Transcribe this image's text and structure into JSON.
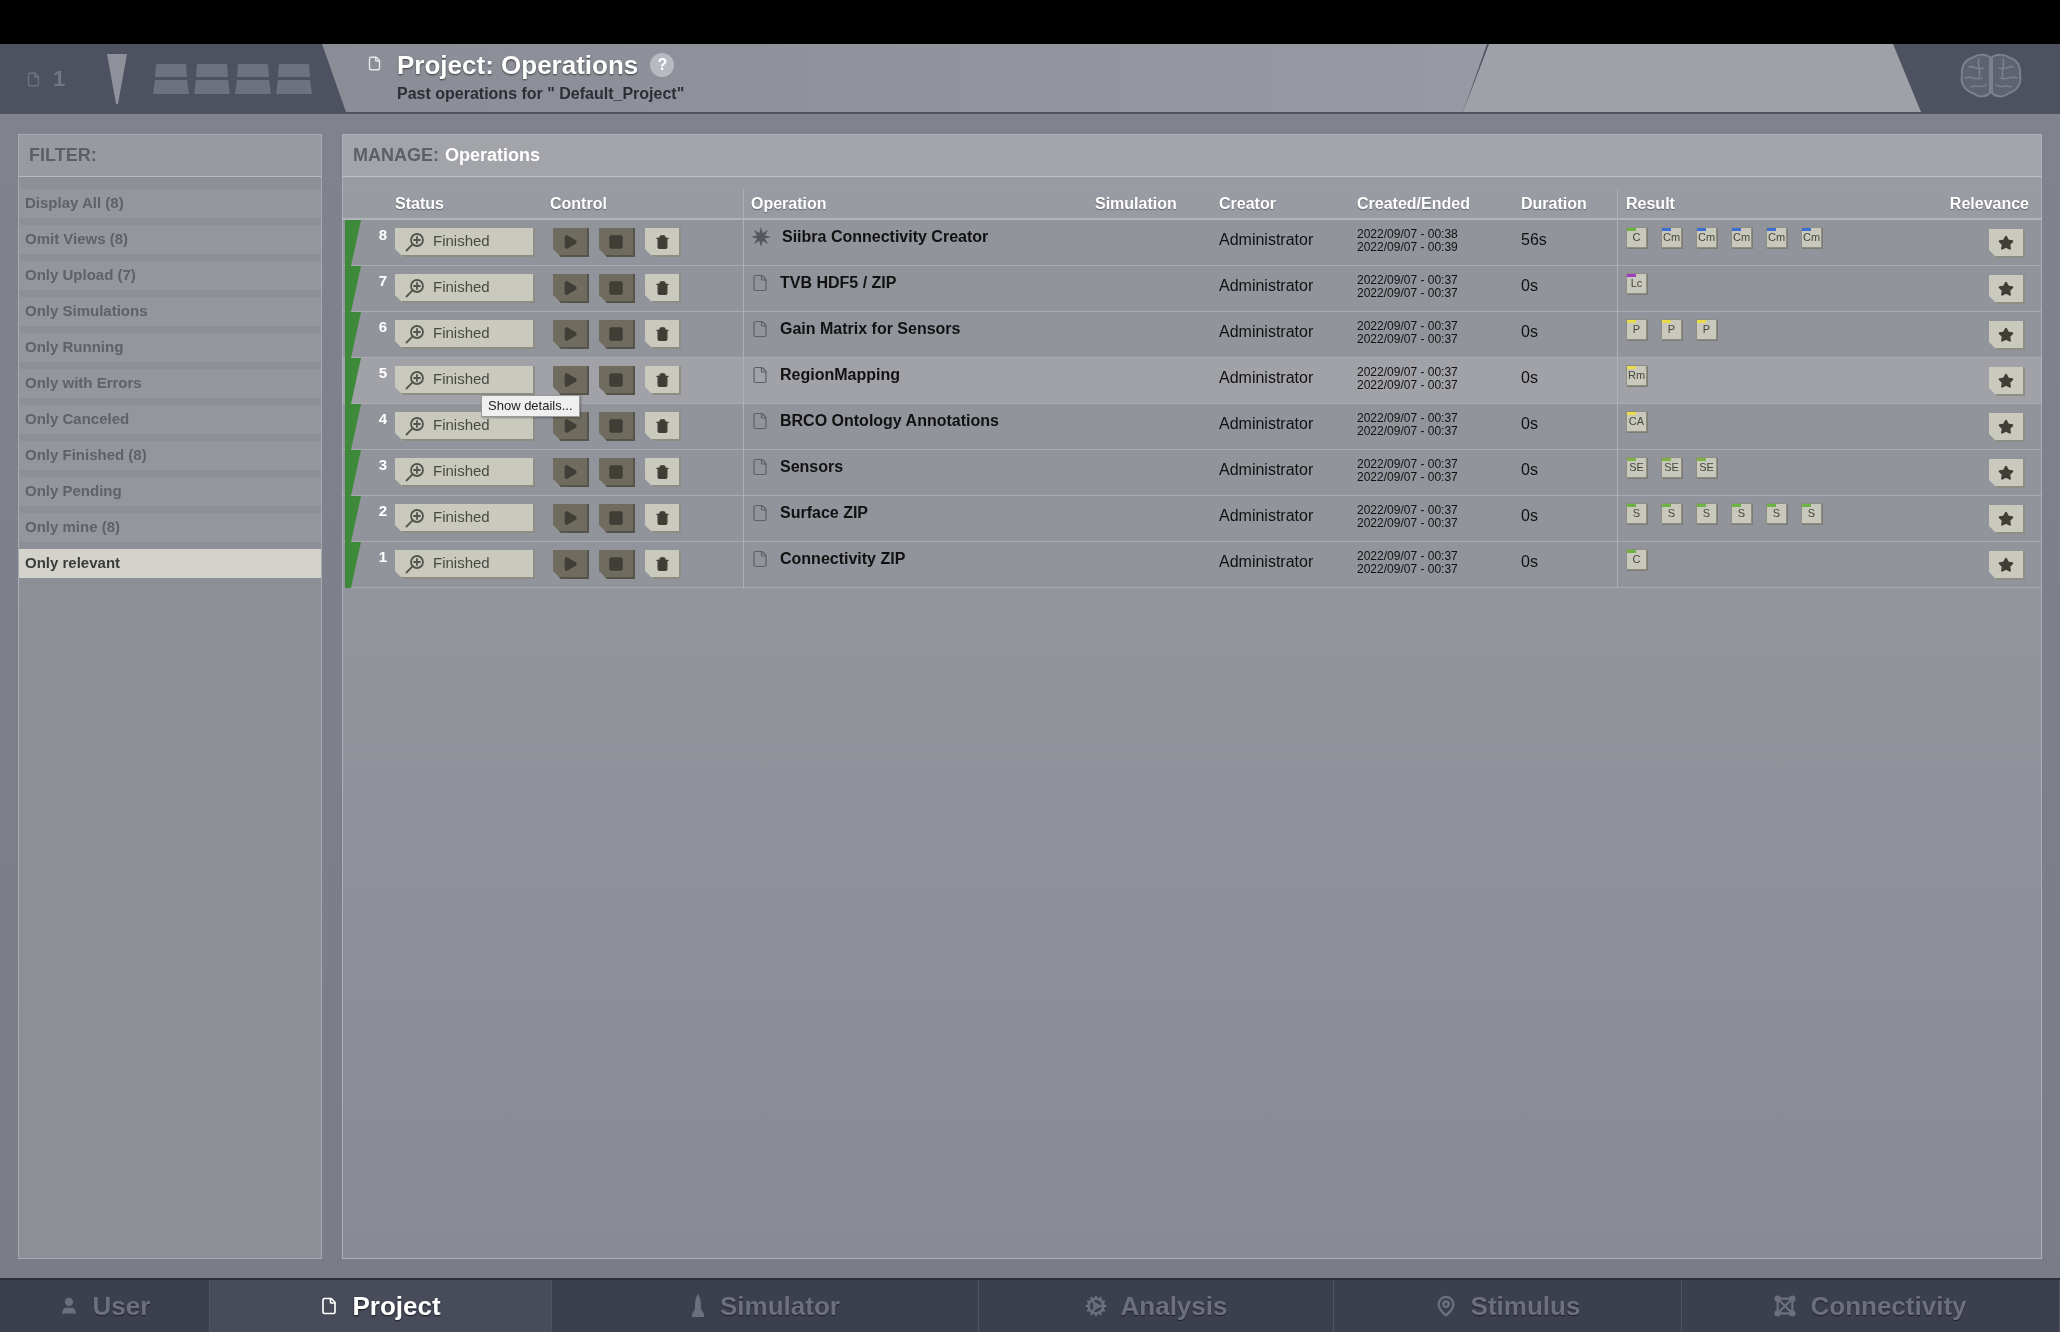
{
  "header": {
    "project_count": "1",
    "title": "Project: Operations",
    "help": "?",
    "subtitle": "Past operations for \" Default_Project\""
  },
  "filter": {
    "label": "FILTER:",
    "items": [
      {
        "label": "Display All (8)",
        "selected": false
      },
      {
        "label": "Omit Views (8)",
        "selected": false
      },
      {
        "label": "Only Upload (7)",
        "selected": false
      },
      {
        "label": "Only Simulations",
        "selected": false
      },
      {
        "label": "Only Running",
        "selected": false
      },
      {
        "label": "Only with Errors",
        "selected": false
      },
      {
        "label": "Only Canceled",
        "selected": false
      },
      {
        "label": "Only Finished (8)",
        "selected": false
      },
      {
        "label": "Only Pending",
        "selected": false
      },
      {
        "label": "Only mine (8)",
        "selected": false
      },
      {
        "label": "Only relevant",
        "selected": true
      }
    ]
  },
  "manage": {
    "label": "MANAGE:",
    "title": "Operations"
  },
  "table": {
    "columns": [
      "Status",
      "Control",
      "Operation",
      "Simulation",
      "Creator",
      "Created/Ended",
      "Duration",
      "Result",
      "Relevance"
    ],
    "rows": [
      {
        "number": "8",
        "color": "#3f8a3a",
        "status": "Finished",
        "kind": "algorithm",
        "operation": "Siibra Connectivity Creator",
        "creator": "Administrator",
        "created": "2022/09/07 - 00:38",
        "ended": "2022/09/07 - 00:39",
        "duration": "56s",
        "hovered": false,
        "results": [
          {
            "label": "C",
            "color": "#6db33f"
          },
          {
            "label": "Cm",
            "color": "#3c6fd8"
          },
          {
            "label": "Cm",
            "color": "#3c6fd8"
          },
          {
            "label": "Cm",
            "color": "#3c6fd8"
          },
          {
            "label": "Cm",
            "color": "#3c6fd8"
          },
          {
            "label": "Cm",
            "color": "#3c6fd8"
          }
        ]
      },
      {
        "number": "7",
        "color": "#3f8a3a",
        "status": "Finished",
        "kind": "upload",
        "operation": "TVB HDF5 / ZIP",
        "creator": "Administrator",
        "created": "2022/09/07 - 00:37",
        "ended": "2022/09/07 - 00:37",
        "duration": "0s",
        "hovered": false,
        "results": [
          {
            "label": "Lc",
            "color": "#a23cc0"
          }
        ]
      },
      {
        "number": "6",
        "color": "#3f8a3a",
        "status": "Finished",
        "kind": "upload",
        "operation": "Gain Matrix for Sensors",
        "creator": "Administrator",
        "created": "2022/09/07 - 00:37",
        "ended": "2022/09/07 - 00:37",
        "duration": "0s",
        "hovered": false,
        "results": [
          {
            "label": "P",
            "color": "#e8dc4a"
          },
          {
            "label": "P",
            "color": "#e8dc4a"
          },
          {
            "label": "P",
            "color": "#e8dc4a"
          }
        ]
      },
      {
        "number": "5",
        "color": "#3f8a3a",
        "status": "Finished",
        "kind": "upload",
        "operation": "RegionMapping",
        "creator": "Administrator",
        "created": "2022/09/07 - 00:37",
        "ended": "2022/09/07 - 00:37",
        "duration": "0s",
        "hovered": true,
        "results": [
          {
            "label": "Rm",
            "color": "#e8dc4a"
          }
        ]
      },
      {
        "number": "4",
        "color": "#3f8a3a",
        "status": "Finished",
        "kind": "upload",
        "operation": "BRCO Ontology Annotations",
        "creator": "Administrator",
        "created": "2022/09/07 - 00:37",
        "ended": "2022/09/07 - 00:37",
        "duration": "0s",
        "hovered": false,
        "results": [
          {
            "label": "CA",
            "color": "#e8dc4a"
          }
        ]
      },
      {
        "number": "3",
        "color": "#3f8a3a",
        "status": "Finished",
        "kind": "upload",
        "operation": "Sensors",
        "creator": "Administrator",
        "created": "2022/09/07 - 00:37",
        "ended": "2022/09/07 - 00:37",
        "duration": "0s",
        "hovered": false,
        "results": [
          {
            "label": "SE",
            "color": "#7cb342"
          },
          {
            "label": "SE",
            "color": "#7cb342"
          },
          {
            "label": "SE",
            "color": "#7cb342"
          }
        ]
      },
      {
        "number": "2",
        "color": "#3f8a3a",
        "status": "Finished",
        "kind": "upload",
        "operation": "Surface ZIP",
        "creator": "Administrator",
        "created": "2022/09/07 - 00:37",
        "ended": "2022/09/07 - 00:37",
        "duration": "0s",
        "hovered": false,
        "results": [
          {
            "label": "S",
            "color": "#6db33f"
          },
          {
            "label": "S",
            "color": "#6db33f"
          },
          {
            "label": "S",
            "color": "#6db33f"
          },
          {
            "label": "S",
            "color": "#6db33f"
          },
          {
            "label": "S",
            "color": "#6db33f"
          },
          {
            "label": "S",
            "color": "#6db33f"
          }
        ]
      },
      {
        "number": "1",
        "color": "#3f8a3a",
        "status": "Finished",
        "kind": "upload",
        "operation": "Connectivity ZIP",
        "creator": "Administrator",
        "created": "2022/09/07 - 00:37",
        "ended": "2022/09/07 - 00:37",
        "duration": "0s",
        "hovered": false,
        "results": [
          {
            "label": "C",
            "color": "#6db33f"
          }
        ]
      }
    ]
  },
  "tooltip": {
    "text": "Show details..."
  },
  "nav_tabs": [
    {
      "label": "User",
      "kind": "user",
      "selected": false
    },
    {
      "label": "Project",
      "kind": "project",
      "selected": true
    },
    {
      "label": "Simulator",
      "kind": "simulator",
      "selected": false
    },
    {
      "label": "Analysis",
      "kind": "analysis",
      "selected": false
    },
    {
      "label": "Stimulus",
      "kind": "stimulus",
      "selected": false
    },
    {
      "label": "Connectivity",
      "kind": "connectivity",
      "selected": false
    }
  ]
}
